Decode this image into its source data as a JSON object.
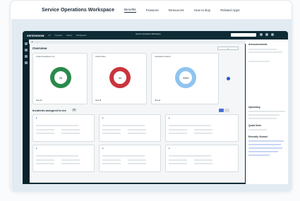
{
  "site": {
    "brand": "Service Operations Workspace",
    "nav": [
      "Benefits",
      "Features",
      "Resources",
      "How to Buy",
      "Related Apps"
    ]
  },
  "app": {
    "logo": "servicenow",
    "menu": [
      "All",
      "Favorites",
      "History",
      "Workspaces"
    ],
    "workspace": "Service Operations Workspace"
  },
  "overview": {
    "title": "Overview",
    "tiles": [
      {
        "title": "Incidents assigned to me",
        "value": "25",
        "color": "#2a8a4b"
      },
      {
        "title": "Critical Cases",
        "value": "34",
        "color": "#c9353d"
      },
      {
        "title": "Unassigned Incidents",
        "value": "2000",
        "color": "#8fc4f0"
      }
    ],
    "view_all": "View all"
  },
  "incidents": {
    "title": "Incidents assigned to me",
    "count": "10"
  },
  "panel": {
    "announcements": "Announcements",
    "upcoming": "Upcoming",
    "quick_links": "Quick links",
    "recently_viewed": "Recently Viewed"
  }
}
